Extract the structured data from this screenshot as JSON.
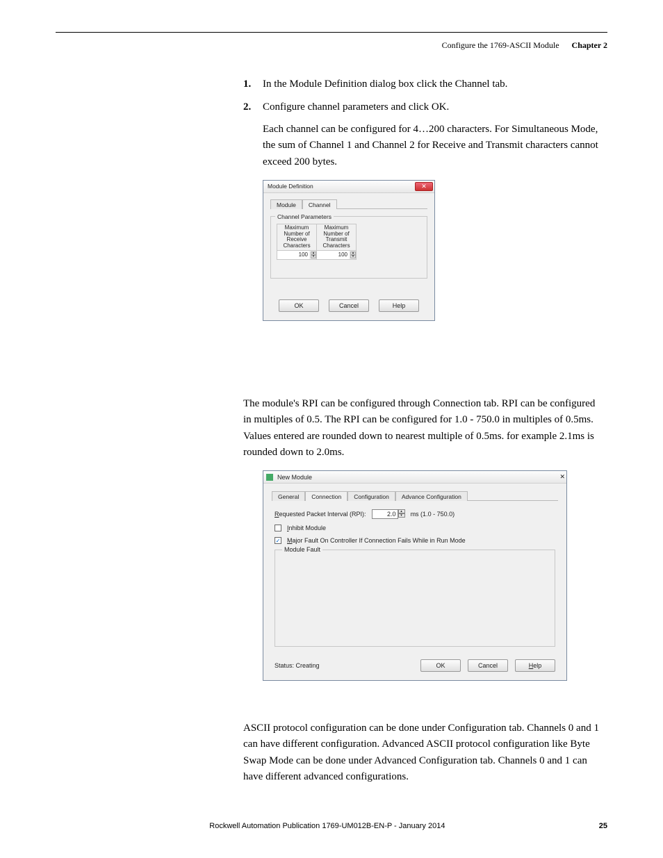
{
  "header": {
    "title": "Configure the 1769-ASCII Module",
    "chapter": "Chapter 2"
  },
  "steps": [
    "In the Module Definition dialog box click the Channel tab.",
    "Configure channel parameters and click OK."
  ],
  "para_after_steps": "Each channel can be configured for 4…200 characters. For Simultaneous Mode, the sum of Channel 1 and Channel 2 for Receive and Transmit characters cannot exceed 200 bytes.",
  "dlg1": {
    "title": "Module Definition",
    "tabs": [
      "Module",
      "Channel"
    ],
    "fieldset": "Channel Parameters",
    "col1": "Maximum\nNumber of\nReceive\nCharacters",
    "col2": "Maximum\nNumber of\nTransmit\nCharacters",
    "val1": "100",
    "val2": "100",
    "ok": "OK",
    "cancel": "Cancel",
    "help": "Help"
  },
  "rpi_para": "The module's RPI can be configured through Connection tab. RPI can be configured in multiples of 0.5. The RPI can be configured for 1.0 - 750.0 in multiples of 0.5ms. Values entered are rounded down to nearest multiple of 0.5ms. for example 2.1ms is rounded down to 2.0ms.",
  "dlg2": {
    "title": "New Module",
    "tabs": [
      "General",
      "Connection",
      "Configuration",
      "Advance Configuration"
    ],
    "rpi_label_pre": "R",
    "rpi_label": "equested Packet Interval (RPI):",
    "rpi_value": "2.0",
    "rpi_range": "ms  (1.0 - 750.0)",
    "inhibit_pre": "I",
    "inhibit": "nhibit Module",
    "majorfault_pre": "M",
    "majorfault": "ajor Fault On Controller If Connection Fails While in Run Mode",
    "modulefault": "Module Fault",
    "status": "Status: Creating",
    "ok": "OK",
    "cancel": "Cancel",
    "help_pre": "H",
    "help": "elp"
  },
  "ascii_para": "ASCII protocol configuration can be done under Configuration tab. Channels 0 and 1 can have different configuration. Advanced ASCII protocol configuration like Byte Swap Mode can be done under Advanced Configuration tab. Channels 0 and 1 can have different advanced configurations.",
  "footer": {
    "pub": "Rockwell Automation Publication 1769-UM012B-EN-P - January 2014",
    "page": "25"
  }
}
